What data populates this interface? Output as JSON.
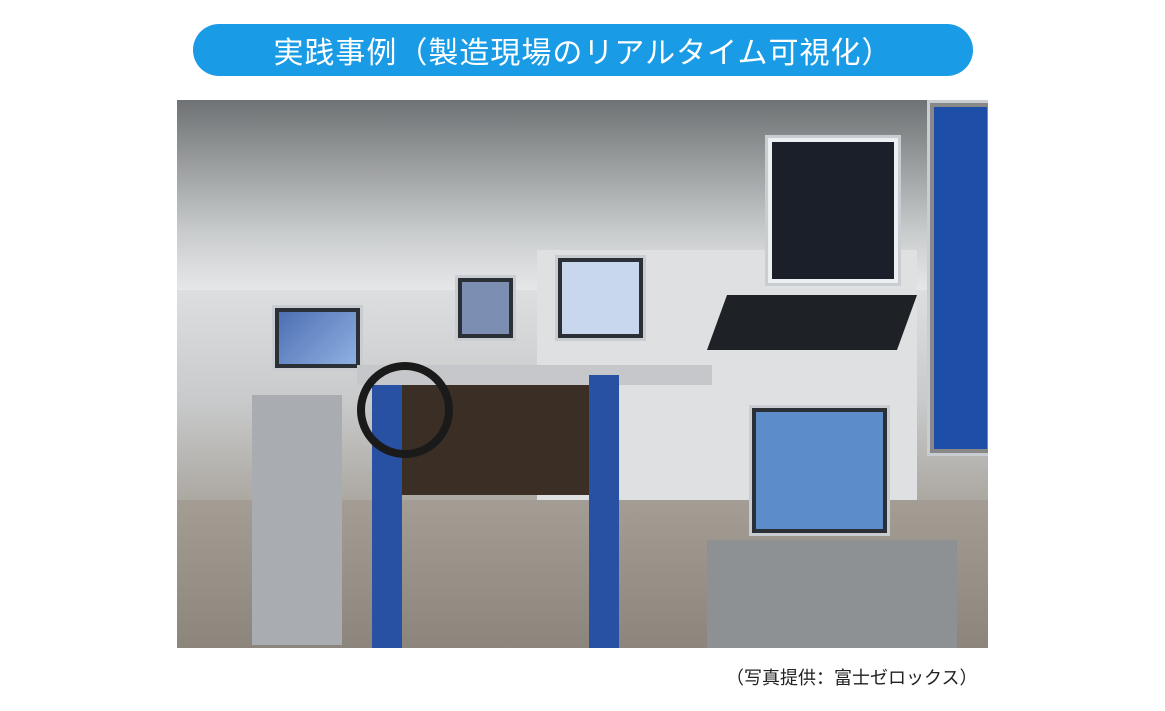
{
  "title": "実践事例（製造現場のリアルタイム可視化）",
  "photo": {
    "subject": "factory-floor-realtime-visualization-demo"
  },
  "caption": "（写真提供：富士ゼロックス）",
  "colors": {
    "title_background": "#1a9be6",
    "title_text": "#ffffff"
  }
}
